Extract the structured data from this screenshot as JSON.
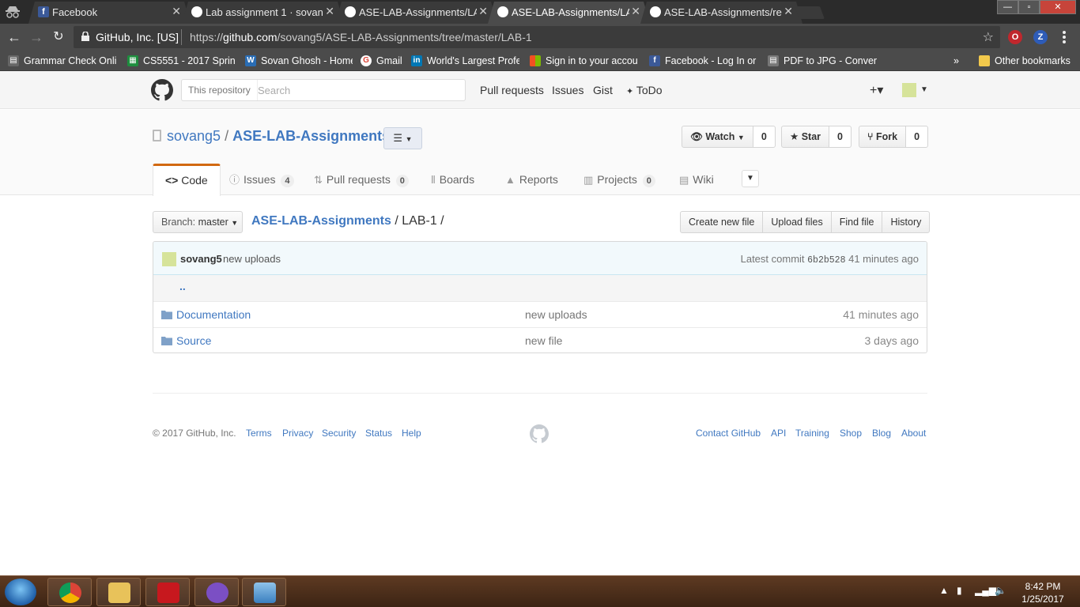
{
  "browser": {
    "tabs": [
      {
        "title": "Facebook",
        "favicon": "facebook-icon"
      },
      {
        "title": "Lab assignment 1 · sovan",
        "favicon": "github-icon"
      },
      {
        "title": "ASE-LAB-Assignments/LA",
        "favicon": "github-icon"
      },
      {
        "title": "ASE-LAB-Assignments/LA",
        "favicon": "github-icon",
        "active": true
      },
      {
        "title": "ASE-LAB-Assignments/re",
        "favicon": "github-icon"
      }
    ],
    "address": {
      "org": "GitHub, Inc. [US]",
      "url_prefix": "https://",
      "url_host": "github.com",
      "url_path": "/sovang5/ASE-LAB-Assignments/tree/master/LAB-1"
    },
    "bookmarks": [
      {
        "label": "Grammar Check Onlin"
      },
      {
        "label": "CS5551 - 2017 Spring"
      },
      {
        "label": "Sovan Ghosh - Home"
      },
      {
        "label": "Gmail"
      },
      {
        "label": "World's Largest Profe"
      },
      {
        "label": "Sign in to your accou"
      },
      {
        "label": "Facebook - Log In or S"
      },
      {
        "label": "PDF to JPG - Convert"
      }
    ],
    "bookmarks_overflow": "»",
    "other_bookmarks": "Other bookmarks"
  },
  "gh_header": {
    "search_scope": "This repository",
    "search_placeholder": "Search",
    "nav": [
      "Pull requests",
      "Issues",
      "Gist",
      "ToDo"
    ],
    "plus": "+▾"
  },
  "repo": {
    "owner": "sovang5",
    "separator": "/",
    "name": "ASE-LAB-Assignments",
    "watch": {
      "label": "Watch",
      "count": "0"
    },
    "star": {
      "label": "Star",
      "count": "0"
    },
    "fork": {
      "label": "Fork",
      "count": "0"
    },
    "tabs": [
      {
        "label": "Code"
      },
      {
        "label": "Issues",
        "count": "4"
      },
      {
        "label": "Pull requests",
        "count": "0"
      },
      {
        "label": "Boards"
      },
      {
        "label": "Reports"
      },
      {
        "label": "Projects",
        "count": "0"
      },
      {
        "label": "Wiki"
      }
    ]
  },
  "filenav": {
    "branch_prefix": "Branch:",
    "branch": "master",
    "crumb_root": "ASE-LAB-Assignments",
    "crumb_sep": "/",
    "crumb_current": "LAB-1 /",
    "buttons": [
      "Create new file",
      "Upload files",
      "Find file",
      "History"
    ]
  },
  "commit": {
    "author": "sovang5",
    "message": "new uploads",
    "latest_label": "Latest commit",
    "sha": "6b2b528",
    "age": "41 minutes ago"
  },
  "files": {
    "up": "..",
    "rows": [
      {
        "name": "Documentation",
        "message": "new uploads",
        "age": "41 minutes ago"
      },
      {
        "name": "Source",
        "message": "new file",
        "age": "3 days ago"
      }
    ]
  },
  "footer": {
    "copyright": "© 2017 GitHub, Inc.",
    "left_links": [
      "Terms",
      "Privacy",
      "Security",
      "Status",
      "Help"
    ],
    "right_links": [
      "Contact GitHub",
      "API",
      "Training",
      "Shop",
      "Blog",
      "About"
    ]
  },
  "taskbar": {
    "time": "8:42 PM",
    "date": "1/25/2017"
  },
  "colors": {
    "link": "#4078c0",
    "tab_accent": "#d26911",
    "chrome_dark": "#4b4b4b",
    "taskbar": "#4a2d1a"
  }
}
